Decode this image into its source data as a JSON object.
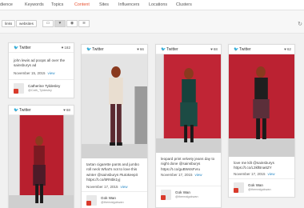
{
  "topnav": {
    "tabs": [
      {
        "label": "udience"
      },
      {
        "label": "Keywords"
      },
      {
        "label": "Topics"
      },
      {
        "label": "Content",
        "active": true
      },
      {
        "label": "Sites"
      },
      {
        "label": "Influencers"
      },
      {
        "label": "Locations"
      },
      {
        "label": "Clusters"
      }
    ]
  },
  "filters": {
    "links": "links",
    "websites": "websites"
  },
  "colors": {
    "accent": "#e8502f",
    "twitter": "#1da1f2",
    "link": "#2a8ac6"
  },
  "cards": [
    {
      "source": "Twitter",
      "likes": "182",
      "text": "john lewis ad poops all over the sainsburys ad",
      "date": "November 15, 2015",
      "view": "view",
      "author_name": "Catherine Tyldesley",
      "author_handle": "@Cath_Tyldesley"
    },
    {
      "source": "Twitter",
      "likes": "68",
      "text": "",
      "date": "",
      "view": "",
      "author_name": "",
      "author_handle": ""
    },
    {
      "source": "Twitter",
      "likes": "66",
      "text": "tartan cigarette pants and jumbo roll neck What's not to love this winter @sainsburys #tutokeepit https://t.co/6RNbk1yj",
      "date": "November 17, 2015",
      "view": "view",
      "author_name": "Gok Wan",
      "author_handle": "@therealgokwan"
    },
    {
      "source": "Twitter",
      "likes": "68",
      "text": "leopard print velvety jeans day to night done @sainsburys https://t.co/guBW4sFvru",
      "date": "November 17, 2015",
      "view": "view",
      "author_name": "Gok Wan",
      "author_handle": "@therealgokwan"
    },
    {
      "source": "Twitter",
      "likes": "62",
      "text": "love me kilt @sainsburys https://t.co/L3kfBna6ZY",
      "date": "November 17, 2015",
      "view": "view",
      "author_name": "Gok Wan",
      "author_handle": "@therealgokwan"
    }
  ]
}
